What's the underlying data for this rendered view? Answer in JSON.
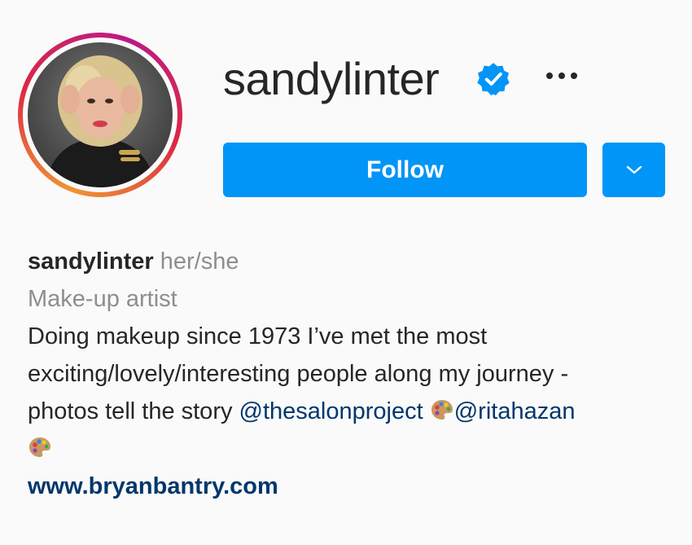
{
  "profile": {
    "username": "sandylinter",
    "verified_icon": "verified-badge-icon",
    "more_icon": "more-options-icon",
    "follow_label": "Follow",
    "dropdown_icon": "chevron-down-icon",
    "accent_color": "#0095f6"
  },
  "bio": {
    "name": "sandylinter",
    "pronouns": "her/she",
    "category": "Make-up artist",
    "line1": "Doing makeup since 1973 I’ve met the most",
    "line2": "exciting/lovely/interesting people along my journey -",
    "line3_prefix": "photos tell the story ",
    "mention1": "@thesalonproject",
    "mention2": "@ritahazan",
    "emoji_icon": "artist-palette-icon",
    "website": "www.bryanbantry.com"
  }
}
